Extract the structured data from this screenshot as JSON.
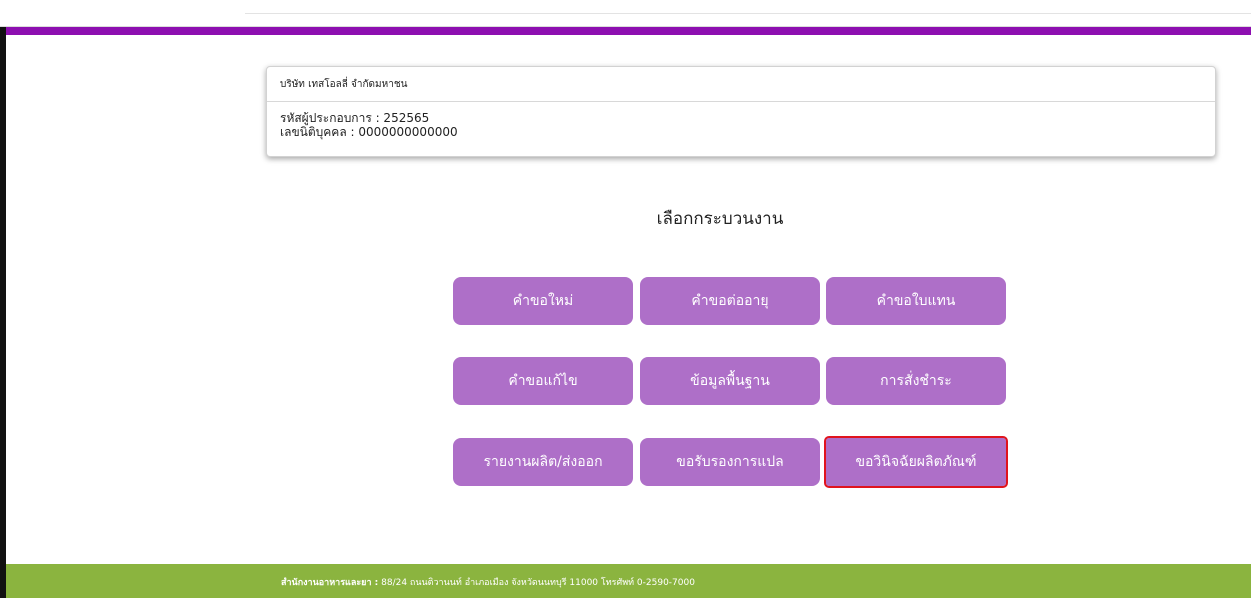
{
  "company": {
    "name": "บริษัท เทสโอลลี่ จำกัดมหาชน",
    "operator_code_line": "รหัสผู้ประกอบการ : 252565",
    "juristic_id_line": "เลขนิติบุคคล : 0000000000000"
  },
  "page": {
    "section_title": "เลือกกระบวนงาน"
  },
  "buttons": {
    "new_request": "คำขอใหม่",
    "renewal_request": "คำขอต่ออายุ",
    "replacement_request": "คำขอใบแทน",
    "amendment_request": "คำขอแก้ไข",
    "basic_info": "ข้อมูลพื้นฐาน",
    "payment_order": "การสั่งชำระ",
    "production_export_report": "รายงานผลิต/ส่งออก",
    "translation_certification": "ขอรับรองการแปล",
    "product_diagnosis": "ขอวินิจฉัยผลิตภัณฑ์"
  },
  "footer": {
    "org_name": "สำนักงานอาหารและยา :",
    "address": " 88/24 ถนนติวานนท์ อำเภอเมือง จังหวัดนนทบุรี 11000 โทรศัพท์ 0-2590-7000"
  },
  "colors": {
    "purple_bar": "#8d0fb0",
    "button_bg": "#ae6fc8",
    "footer_bg": "#8bb43f",
    "highlight": "#e0141e"
  }
}
